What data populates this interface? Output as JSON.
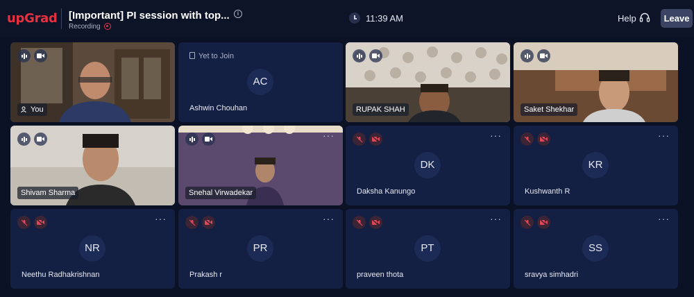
{
  "header": {
    "logo": "upGrad",
    "session_title": "[Important] PI session with top...",
    "info_icon": "i",
    "recording_label": "Recording",
    "time": "11:39 AM",
    "help_label": "Help",
    "leave_label": "Leave"
  },
  "participants": [
    {
      "name": "You",
      "video": true,
      "mic": "on",
      "cam": "on"
    },
    {
      "name": "Ashwin Chouhan",
      "initials": "AC",
      "status": "Yet to Join",
      "video": false
    },
    {
      "name": "RUPAK SHAH",
      "video": true,
      "mic": "on",
      "cam": "on"
    },
    {
      "name": "Saket Shekhar",
      "video": true,
      "mic": "on",
      "cam": "on"
    },
    {
      "name": "Shivam Sharma",
      "video": true,
      "mic": "on",
      "cam": "on"
    },
    {
      "name": "Snehal Virwadekar",
      "video": true,
      "mic": "on",
      "cam": "on"
    },
    {
      "name": "Daksha Kanungo",
      "initials": "DK",
      "video": false,
      "mic": "off",
      "cam": "off"
    },
    {
      "name": "Kushwanth R",
      "initials": "KR",
      "video": false,
      "mic": "off",
      "cam": "off"
    },
    {
      "name": "Neethu Radhakrishnan",
      "initials": "NR",
      "video": false,
      "mic": "off",
      "cam": "off"
    },
    {
      "name": "Prakash r",
      "initials": "PR",
      "video": false,
      "mic": "off",
      "cam": "off"
    },
    {
      "name": "praveen thota",
      "initials": "PT",
      "video": false,
      "mic": "off",
      "cam": "off"
    },
    {
      "name": "sravya simhadri",
      "initials": "SS",
      "video": false,
      "mic": "off",
      "cam": "off"
    }
  ],
  "more_glyph": "···",
  "colors": {
    "brand": "#e8313f",
    "background": "#0b1226",
    "tile": "#142043",
    "avatar": "#1c2b56",
    "muted": "#e0475a"
  }
}
